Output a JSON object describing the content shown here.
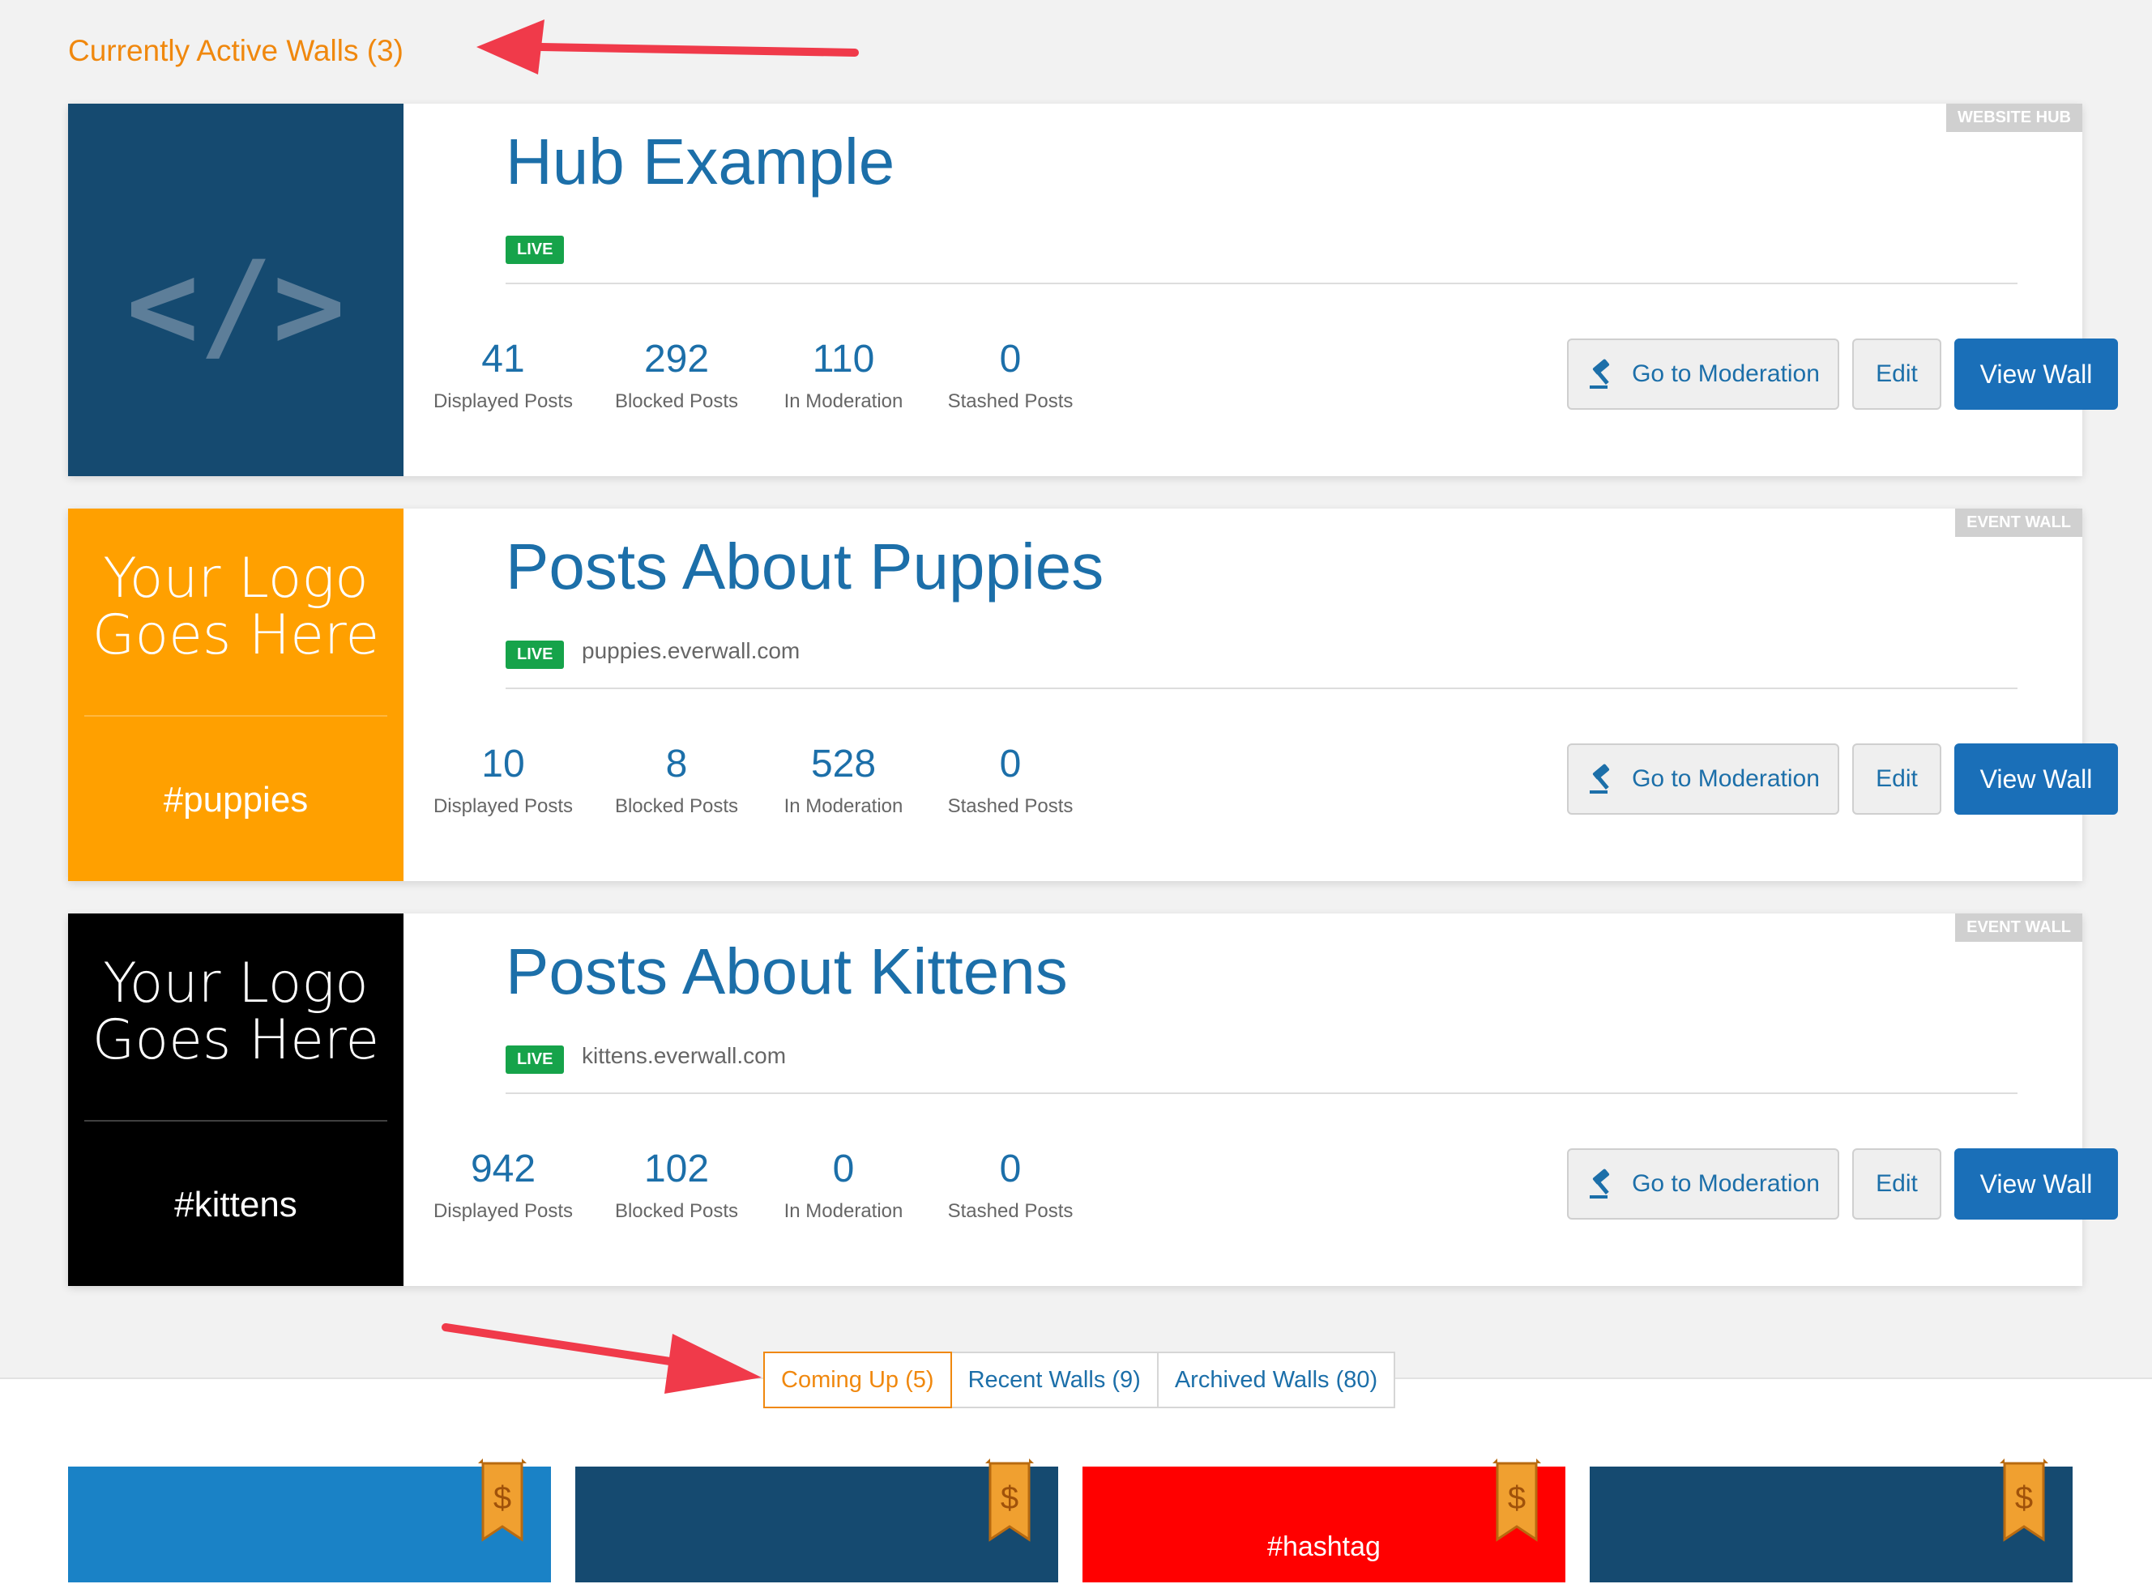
{
  "section_title": "Currently Active Walls (3)",
  "labels": {
    "displayed": "Displayed Posts",
    "blocked": "Blocked Posts",
    "moderation": "In Moderation",
    "stashed": "Stashed Posts",
    "go_to_moderation": "Go to Moderation",
    "edit": "Edit",
    "view_wall": "View Wall"
  },
  "walls": [
    {
      "title": "Hub Example",
      "type_badge": "WEBSITE HUB",
      "status": "LIVE",
      "url": "",
      "logo_icon": "code-icon",
      "logo_color": "#154a70",
      "stats": {
        "displayed": "41",
        "blocked": "292",
        "moderation": "110",
        "stashed": "0"
      }
    },
    {
      "title": "Posts About Puppies",
      "type_badge": "EVENT WALL",
      "status": "LIVE",
      "url": "puppies.everwall.com",
      "logo_text_1": "Your Logo",
      "logo_text_2": "Goes Here",
      "logo_hashtag": "#puppies",
      "logo_color": "#ffa000",
      "stats": {
        "displayed": "10",
        "blocked": "8",
        "moderation": "528",
        "stashed": "0"
      }
    },
    {
      "title": "Posts About Kittens",
      "type_badge": "EVENT WALL",
      "status": "LIVE",
      "url": "kittens.everwall.com",
      "logo_text_1": "Your Logo",
      "logo_text_2": "Goes Here",
      "logo_hashtag": "#kittens",
      "logo_color": "#000000",
      "stats": {
        "displayed": "942",
        "blocked": "102",
        "moderation": "0",
        "stashed": "0"
      }
    }
  ],
  "tabs": [
    {
      "label": "Coming Up (5)",
      "active": true
    },
    {
      "label": "Recent Walls (9)",
      "active": false
    },
    {
      "label": "Archived Walls (80)",
      "active": false
    }
  ],
  "upcoming": [
    {
      "color": "#1a82c6",
      "hashtag": "",
      "badge_icon": "dollar-ribbon-icon",
      "badge_text": "$"
    },
    {
      "color": "#154a70",
      "hashtag": "",
      "badge_icon": "dollar-ribbon-icon",
      "badge_text": "$"
    },
    {
      "color": "#ff0000",
      "hashtag": "#hashtag",
      "badge_icon": "dollar-ribbon-icon",
      "badge_text": "$"
    },
    {
      "color": "#154a70",
      "hashtag": "",
      "badge_icon": "dollar-ribbon-icon",
      "badge_text": "$"
    }
  ],
  "colors": {
    "accent_orange": "#f0880e",
    "link_blue": "#1c6fa9",
    "primary_button": "#1a6fb8",
    "live_green": "#16a34a",
    "annotation_arrow": "#f03a4a"
  }
}
